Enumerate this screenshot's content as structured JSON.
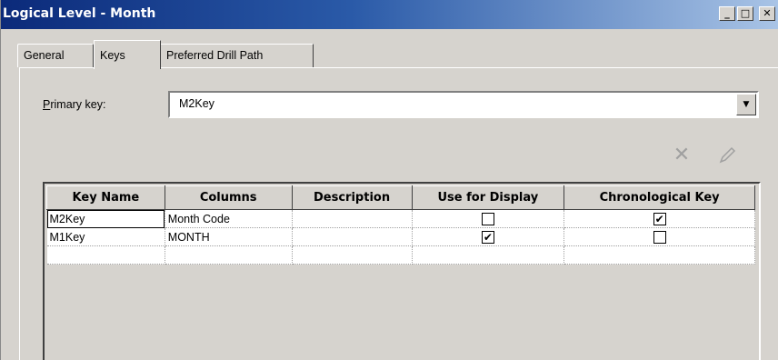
{
  "window": {
    "title": "Logical Level - Month",
    "buttons": [
      "_",
      "□",
      "✕"
    ]
  },
  "tabs": [
    {
      "label": "General",
      "active": false
    },
    {
      "label": "Keys",
      "active": true
    },
    {
      "label": "Preferred Drill Path",
      "active": false
    }
  ],
  "primary_key": {
    "label_underlined": "P",
    "label_rest": "rimary key:",
    "value": "M2Key"
  },
  "toolbar": {
    "delete_icon": "delete-icon",
    "edit_icon": "edit-icon"
  },
  "table": {
    "headers": [
      "Key Name",
      "Columns",
      "Description",
      "Use for Display",
      "Chronological Key"
    ],
    "rows": [
      {
        "key_name": "M2Key",
        "columns": "Month Code",
        "description": "",
        "use_for_display": false,
        "chronological_key": true
      },
      {
        "key_name": "M1Key",
        "columns": "MONTH",
        "description": "",
        "use_for_display": true,
        "chronological_key": false
      }
    ]
  }
}
